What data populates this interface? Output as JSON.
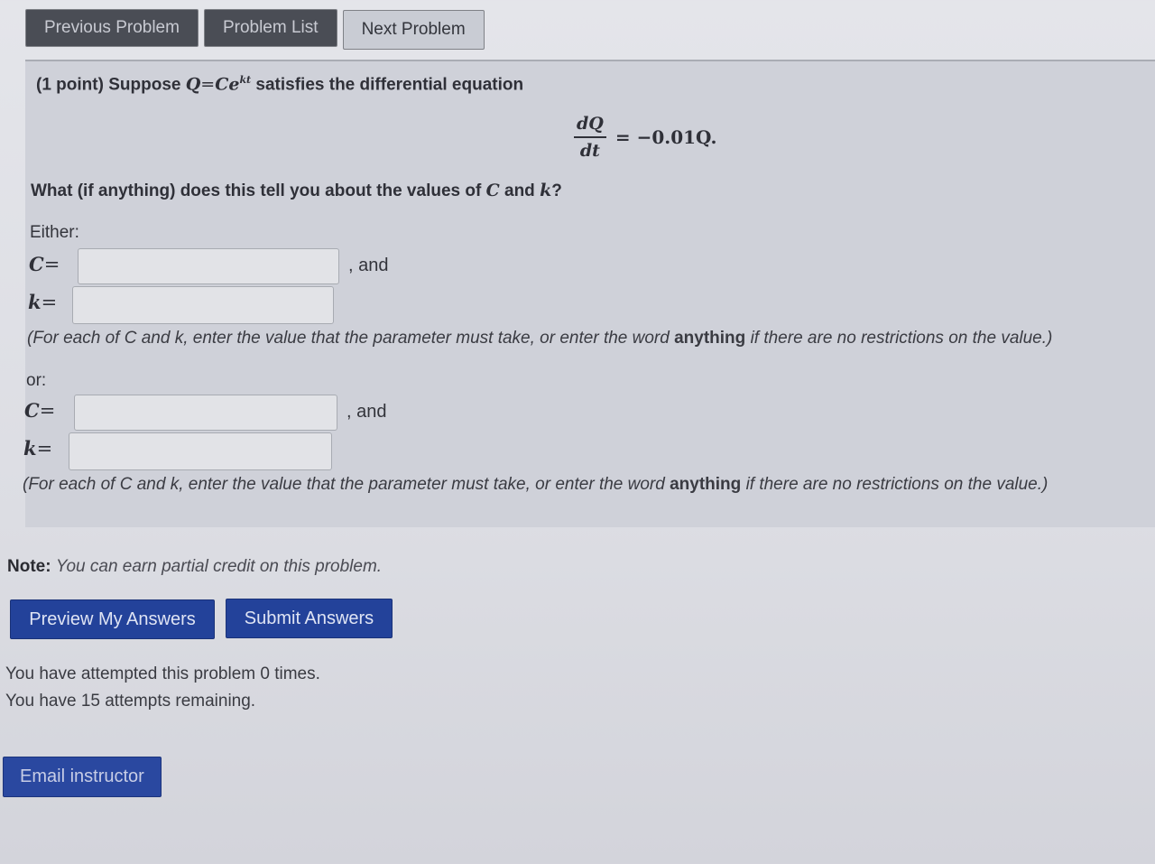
{
  "nav": {
    "previous": "Previous Problem",
    "list": "Problem List",
    "next": "Next Problem"
  },
  "problem": {
    "points": "(1 point)",
    "suppose": "Suppose",
    "q_var": "Q",
    "eq_sign": "=",
    "c_var": "Ce",
    "exponent": "kt",
    "satisfies": "satisfies the differential equation",
    "deriv_num": "dQ",
    "deriv_den": "dt",
    "rhs": "= −0.01Q.",
    "question_pre": "What (if anything) does this tell you about the values of",
    "question_c": "C",
    "question_and": "and",
    "question_k": "k",
    "question_end": "?",
    "either": "Either:",
    "or": "or:",
    "c_label": "C",
    "k_label": "k",
    "equals": "=",
    "and_text": ", and",
    "hint_pre": "(For each of C and k, enter the value that the parameter must take, or enter the word",
    "hint_bold": "anything",
    "hint_post": "if there are no restrictions on the value.)",
    "inputs": {
      "c1": "",
      "k1": "",
      "c2": "",
      "k2": ""
    }
  },
  "note": {
    "label": "Note:",
    "text": "You can earn partial credit on this problem."
  },
  "buttons": {
    "preview": "Preview My Answers",
    "submit": "Submit Answers",
    "email": "Email instructor"
  },
  "attempts": {
    "line1": "You have attempted this problem 0 times.",
    "line2": "You have 15 attempts remaining."
  }
}
